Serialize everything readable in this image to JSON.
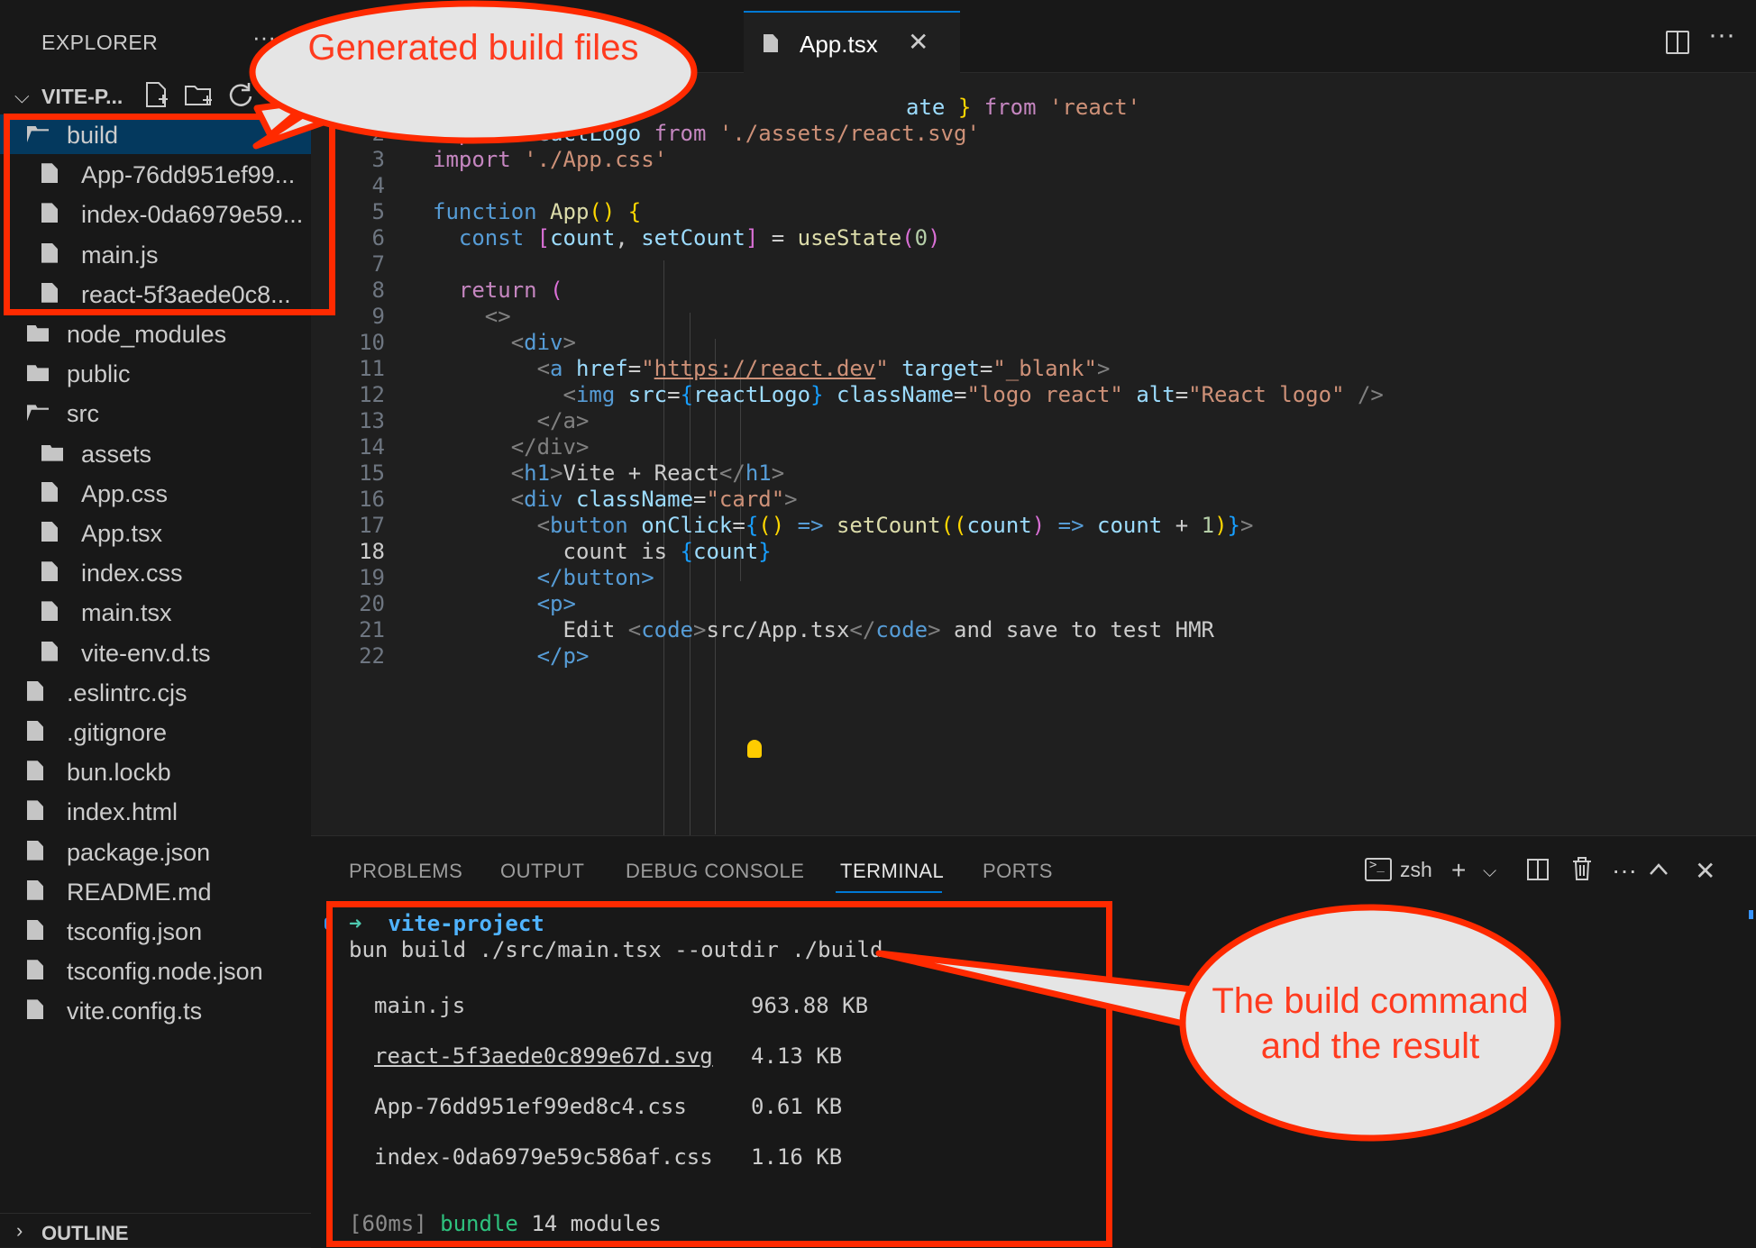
{
  "sidebar": {
    "title": "EXPLORER",
    "more": "···",
    "project_name": "VITE-P...",
    "items": [
      {
        "label": "build",
        "type": "folder-open",
        "indent": 0
      },
      {
        "label": "App-76dd951ef99...",
        "type": "file",
        "indent": 1
      },
      {
        "label": "index-0da6979e59...",
        "type": "file",
        "indent": 1
      },
      {
        "label": "main.js",
        "type": "file",
        "indent": 1
      },
      {
        "label": "react-5f3aede0c8...",
        "type": "file",
        "indent": 1
      },
      {
        "label": "node_modules",
        "type": "folder",
        "indent": 0
      },
      {
        "label": "public",
        "type": "folder",
        "indent": 0
      },
      {
        "label": "src",
        "type": "folder-open",
        "indent": 0
      },
      {
        "label": "assets",
        "type": "folder",
        "indent": 1
      },
      {
        "label": "App.css",
        "type": "file",
        "indent": 1
      },
      {
        "label": "App.tsx",
        "type": "file",
        "indent": 1
      },
      {
        "label": "index.css",
        "type": "file",
        "indent": 1
      },
      {
        "label": "main.tsx",
        "type": "file",
        "indent": 1
      },
      {
        "label": "vite-env.d.ts",
        "type": "file",
        "indent": 1
      },
      {
        "label": ".eslintrc.cjs",
        "type": "file",
        "indent": 0
      },
      {
        "label": ".gitignore",
        "type": "file",
        "indent": 0
      },
      {
        "label": "bun.lockb",
        "type": "file",
        "indent": 0
      },
      {
        "label": "index.html",
        "type": "file",
        "indent": 0
      },
      {
        "label": "package.json",
        "type": "file",
        "indent": 0
      },
      {
        "label": "README.md",
        "type": "file",
        "indent": 0
      },
      {
        "label": "tsconfig.json",
        "type": "file",
        "indent": 0
      },
      {
        "label": "tsconfig.node.json",
        "type": "file",
        "indent": 0
      },
      {
        "label": "vite.config.ts",
        "type": "file",
        "indent": 0
      }
    ],
    "outline": "OUTLINE"
  },
  "tabs": {
    "active_label": "App.tsx",
    "close": "✕",
    "more": "···"
  },
  "editor": {
    "line_numbers": [
      "2",
      "3",
      "4",
      "5",
      "6",
      "7",
      "8",
      "9",
      "10",
      "11",
      "12",
      "13",
      "14",
      "15",
      "16",
      "17",
      "18",
      "19",
      "20",
      "21",
      "22"
    ],
    "active_line": "18",
    "line1_partial": {
      "a": "ate",
      "b": "}",
      "c": "from",
      "d": "'react'"
    },
    "code": {
      "l2": {
        "kw": "import",
        "v": "reactLogo",
        "from": "from",
        "s": "'./assets/react.svg'"
      },
      "l3": {
        "kw": "import",
        "s": "'./App.css'"
      },
      "l5": {
        "kw": "function",
        "fn": "App",
        "p": "()",
        "b": "{"
      },
      "l6": {
        "kw": "const",
        "b1": "[",
        "v1": "count",
        "c": ",",
        "v2": "setCount",
        "b2": "]",
        "eq": "=",
        "fn": "useState",
        "p1": "(",
        "n": "0",
        "p2": ")"
      },
      "l8": {
        "kw": "return",
        "p": "("
      },
      "l9": {
        "t": "<>"
      },
      "l10": {
        "o": "<",
        "t": "div",
        "c": ">"
      },
      "l11": {
        "o": "<",
        "t": "a",
        "a1": "href",
        "eq1": "=",
        "q1": "\"",
        "url": "https://react.dev",
        "q2": "\"",
        "a2": "target",
        "eq2": "=",
        "s2": "\"_blank\"",
        "c": ">"
      },
      "l12": {
        "o": "<",
        "t": "img",
        "a1": "src",
        "eq1": "=",
        "b1": "{",
        "v": "reactLogo",
        "b2": "}",
        "a2": "className",
        "eq2": "=",
        "s2": "\"logo react\"",
        "a3": "alt",
        "eq3": "=",
        "s3": "\"React logo\"",
        "c": "/>"
      },
      "l13": {
        "t": "</a>"
      },
      "l14": {
        "t": "</div>"
      },
      "l15": {
        "o": "<",
        "t": "h1",
        "c": ">",
        "text": "Vite + React",
        "o2": "</",
        "t2": "h1",
        "c2": ">"
      },
      "l16": {
        "o": "<",
        "t": "div",
        "a": "className",
        "eq": "=",
        "s": "\"card\"",
        "c": ">"
      },
      "l17": {
        "o": "<",
        "t": "button",
        "a": "onClick",
        "eq": "=",
        "b1": "{",
        "p1": "()",
        "arrow": "=>",
        "fn": "setCount",
        "p2": "((",
        "v1": "count",
        "p3": ")",
        "arrow2": "=>",
        "v2": "count",
        "plus": "+",
        "n": "1",
        "p4": ")",
        "b2": "}",
        "c": ">"
      },
      "l18": {
        "text": "count is",
        "b1": "{",
        "v": "count",
        "b2": "}"
      },
      "l19": {
        "t": "</button>"
      },
      "l20": {
        "t": "<p>"
      },
      "l21": {
        "text": "Edit",
        "o1": "<",
        "t1": "code",
        "c1": ">",
        "inner": "src/App.tsx",
        "o2": "</",
        "t2": "code",
        "c2": ">",
        "rest": "and save to test HMR"
      },
      "l22": {
        "t": "</p>"
      }
    }
  },
  "panel": {
    "tabs": [
      "PROBLEMS",
      "OUTPUT",
      "DEBUG CONSOLE",
      "TERMINAL",
      "PORTS"
    ],
    "active_tab": "TERMINAL",
    "shell": "zsh",
    "terminal": {
      "prompt_arrow": "➜",
      "dir": "vite-project",
      "command": "bun build ./src/main.tsx --outdir ./build",
      "outputs": [
        {
          "name": "main.js",
          "size": "963.88 KB"
        },
        {
          "name": "react-5f3aede0c899e67d.svg",
          "size": "4.13 KB"
        },
        {
          "name": "App-76dd951ef99ed8c4.css",
          "size": "0.61 KB"
        },
        {
          "name": "index-0da6979e59c586af.css",
          "size": "1.16 KB"
        }
      ],
      "time": "[60ms]",
      "bundle_word": "bundle",
      "modules": "14 modules"
    }
  },
  "annotations": {
    "callout_top": "Generated build files",
    "callout_bottom": "The build command and the result",
    "color": "#ff2a00",
    "bubble_fill": "#e5e5e5"
  }
}
